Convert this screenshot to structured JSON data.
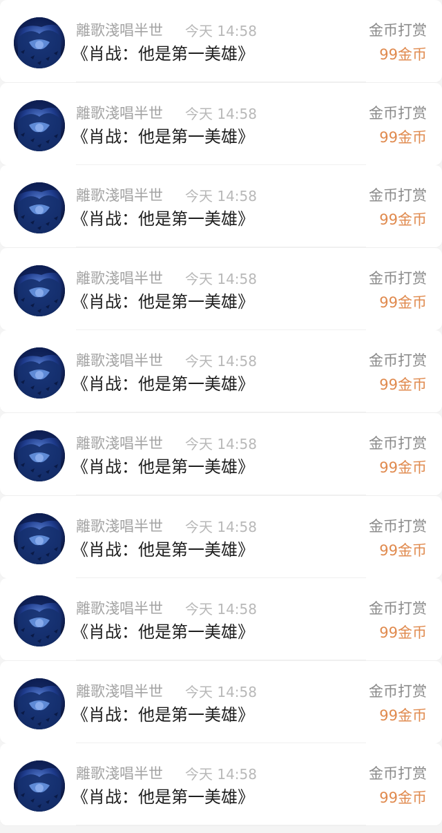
{
  "accent_color": "#e08a4e",
  "list": {
    "items": [
      {
        "avatar_icon": "avatar-icon",
        "user": "離歌淺唱半世",
        "time": "今天 14:58",
        "title": "《肖战：他是第一美雄》",
        "action": "金币打赏",
        "amount": "99金币"
      },
      {
        "avatar_icon": "avatar-icon",
        "user": "離歌淺唱半世",
        "time": "今天 14:58",
        "title": "《肖战：他是第一美雄》",
        "action": "金币打赏",
        "amount": "99金币"
      },
      {
        "avatar_icon": "avatar-icon",
        "user": "離歌淺唱半世",
        "time": "今天 14:58",
        "title": "《肖战：他是第一美雄》",
        "action": "金币打赏",
        "amount": "99金币"
      },
      {
        "avatar_icon": "avatar-icon",
        "user": "離歌淺唱半世",
        "time": "今天 14:58",
        "title": "《肖战：他是第一美雄》",
        "action": "金币打赏",
        "amount": "99金币"
      },
      {
        "avatar_icon": "avatar-icon",
        "user": "離歌淺唱半世",
        "time": "今天 14:58",
        "title": "《肖战：他是第一美雄》",
        "action": "金币打赏",
        "amount": "99金币"
      },
      {
        "avatar_icon": "avatar-icon",
        "user": "離歌淺唱半世",
        "time": "今天 14:58",
        "title": "《肖战：他是第一美雄》",
        "action": "金币打赏",
        "amount": "99金币"
      },
      {
        "avatar_icon": "avatar-icon",
        "user": "離歌淺唱半世",
        "time": "今天 14:58",
        "title": "《肖战：他是第一美雄》",
        "action": "金币打赏",
        "amount": "99金币"
      },
      {
        "avatar_icon": "avatar-icon",
        "user": "離歌淺唱半世",
        "time": "今天 14:58",
        "title": "《肖战：他是第一美雄》",
        "action": "金币打赏",
        "amount": "99金币"
      },
      {
        "avatar_icon": "avatar-icon",
        "user": "離歌淺唱半世",
        "time": "今天 14:58",
        "title": "《肖战：他是第一美雄》",
        "action": "金币打赏",
        "amount": "99金币"
      },
      {
        "avatar_icon": "avatar-icon",
        "user": "離歌淺唱半世",
        "time": "今天 14:58",
        "title": "《肖战：他是第一美雄》",
        "action": "金币打赏",
        "amount": "99金币"
      }
    ]
  }
}
